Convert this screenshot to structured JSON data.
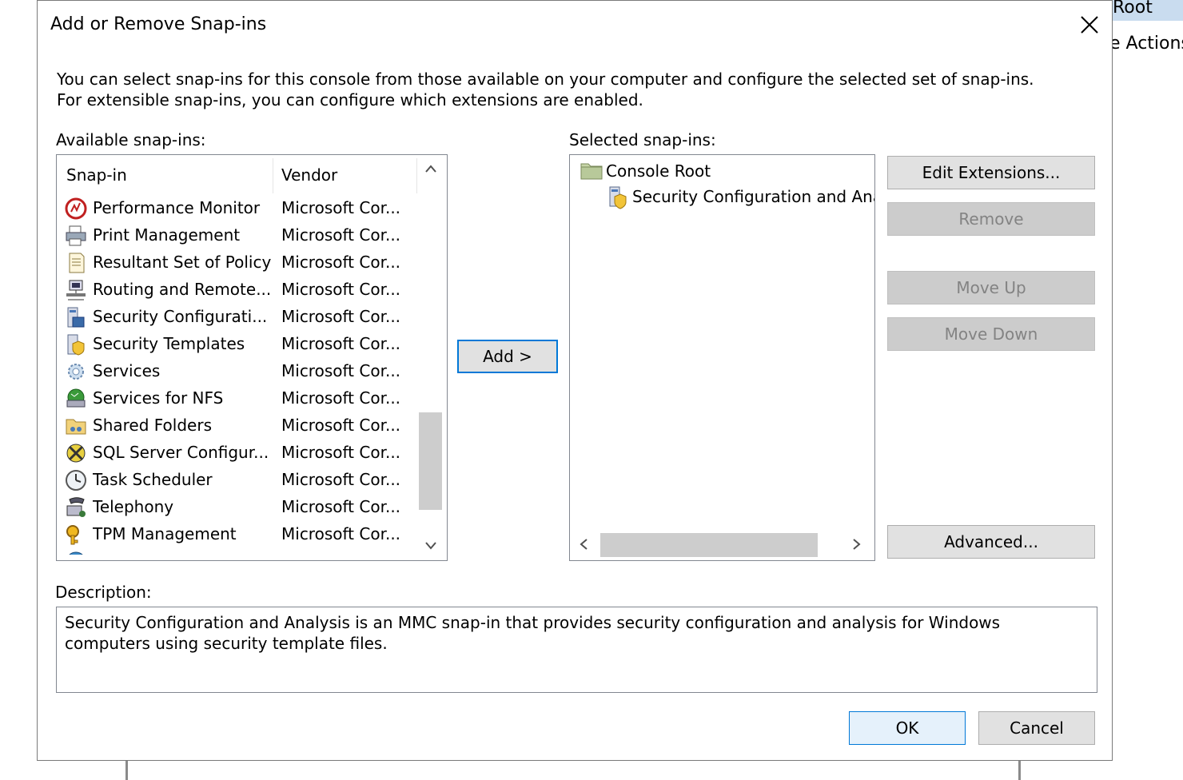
{
  "background": {
    "header_text": "Root",
    "actions_text": "e Actions"
  },
  "dialog": {
    "title": "Add or Remove Snap-ins",
    "intro": "You can select snap-ins for this console from those available on your computer and configure the selected set of snap-ins. For extensible snap-ins, you can configure which extensions are enabled.",
    "available_label": "Available snap-ins:",
    "selected_label": "Selected snap-ins:",
    "columns": {
      "snapin": "Snap-in",
      "vendor": "Vendor"
    },
    "available_items": [
      {
        "name": "Performance Monitor",
        "vendor": "Microsoft Cor...",
        "icon": "performance-monitor-icon"
      },
      {
        "name": "Print Management",
        "vendor": "Microsoft Cor...",
        "icon": "printer-icon"
      },
      {
        "name": "Resultant Set of Policy",
        "vendor": "Microsoft Cor...",
        "icon": "policy-document-icon"
      },
      {
        "name": "Routing and Remote...",
        "vendor": "Microsoft Cor...",
        "icon": "routing-computer-icon"
      },
      {
        "name": "Security Configurati...",
        "vendor": "Microsoft Cor...",
        "icon": "security-config-icon"
      },
      {
        "name": "Security Templates",
        "vendor": "Microsoft Cor...",
        "icon": "security-templates-icon"
      },
      {
        "name": "Services",
        "vendor": "Microsoft Cor...",
        "icon": "services-gear-icon"
      },
      {
        "name": "Services for NFS",
        "vendor": "Microsoft Cor...",
        "icon": "nfs-icon"
      },
      {
        "name": "Shared Folders",
        "vendor": "Microsoft Cor...",
        "icon": "shared-folder-icon"
      },
      {
        "name": "SQL Server Configur...",
        "vendor": "Microsoft Cor...",
        "icon": "sql-tools-icon"
      },
      {
        "name": "Task Scheduler",
        "vendor": "Microsoft Cor...",
        "icon": "clock-icon"
      },
      {
        "name": "Telephony",
        "vendor": "Microsoft Cor...",
        "icon": "telephony-icon"
      },
      {
        "name": "TPM Management",
        "vendor": "Microsoft Cor...",
        "icon": "tpm-key-icon"
      }
    ],
    "add_button": "Add >",
    "selected_items": [
      {
        "name": "Console Root",
        "icon": "folder-icon"
      },
      {
        "name": "Security Configuration and Ana",
        "icon": "security-config-icon"
      }
    ],
    "buttons": {
      "edit_extensions": "Edit Extensions...",
      "remove": "Remove",
      "move_up": "Move Up",
      "move_down": "Move Down",
      "advanced": "Advanced..."
    },
    "description_label": "Description:",
    "description": "Security Configuration and Analysis is an MMC snap-in that provides security configuration and analysis for Windows computers using security template files.",
    "ok": "OK",
    "cancel": "Cancel"
  }
}
